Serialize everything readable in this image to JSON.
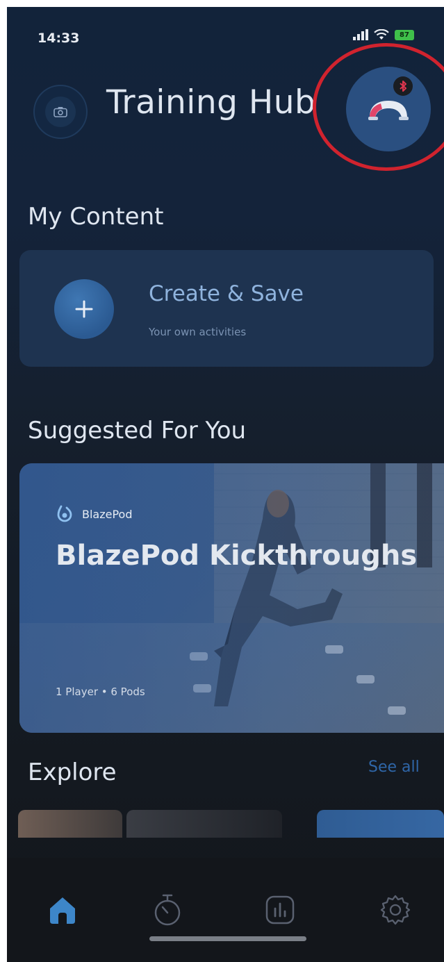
{
  "status_bar": {
    "time": "14:33",
    "battery": "87"
  },
  "header": {
    "title": "Training Hub",
    "camera_icon": "camera-icon",
    "pods_icon": "pods-connection-icon",
    "bluetooth_icon": "bluetooth-off-icon"
  },
  "my_content": {
    "heading": "My Content",
    "create": {
      "title": "Create & Save",
      "subtitle": "Your own activities",
      "icon": "plus-icon"
    }
  },
  "suggested": {
    "heading": "Suggested For You",
    "card": {
      "brand": "BlazePod",
      "title": "BlazePod Kickthroughs",
      "meta": "1 Player • 6 Pods"
    }
  },
  "explore": {
    "heading": "Explore",
    "see_all": "See all"
  },
  "tab_bar": {
    "items": [
      {
        "icon": "home-icon",
        "active": true
      },
      {
        "icon": "stopwatch-icon",
        "active": false
      },
      {
        "icon": "stats-icon",
        "active": false
      },
      {
        "icon": "settings-gear-icon",
        "active": false
      }
    ]
  },
  "colors": {
    "accent": "#2f66a8",
    "highlight_ring": "#d0232e",
    "active_tab": "#3d86c9"
  }
}
